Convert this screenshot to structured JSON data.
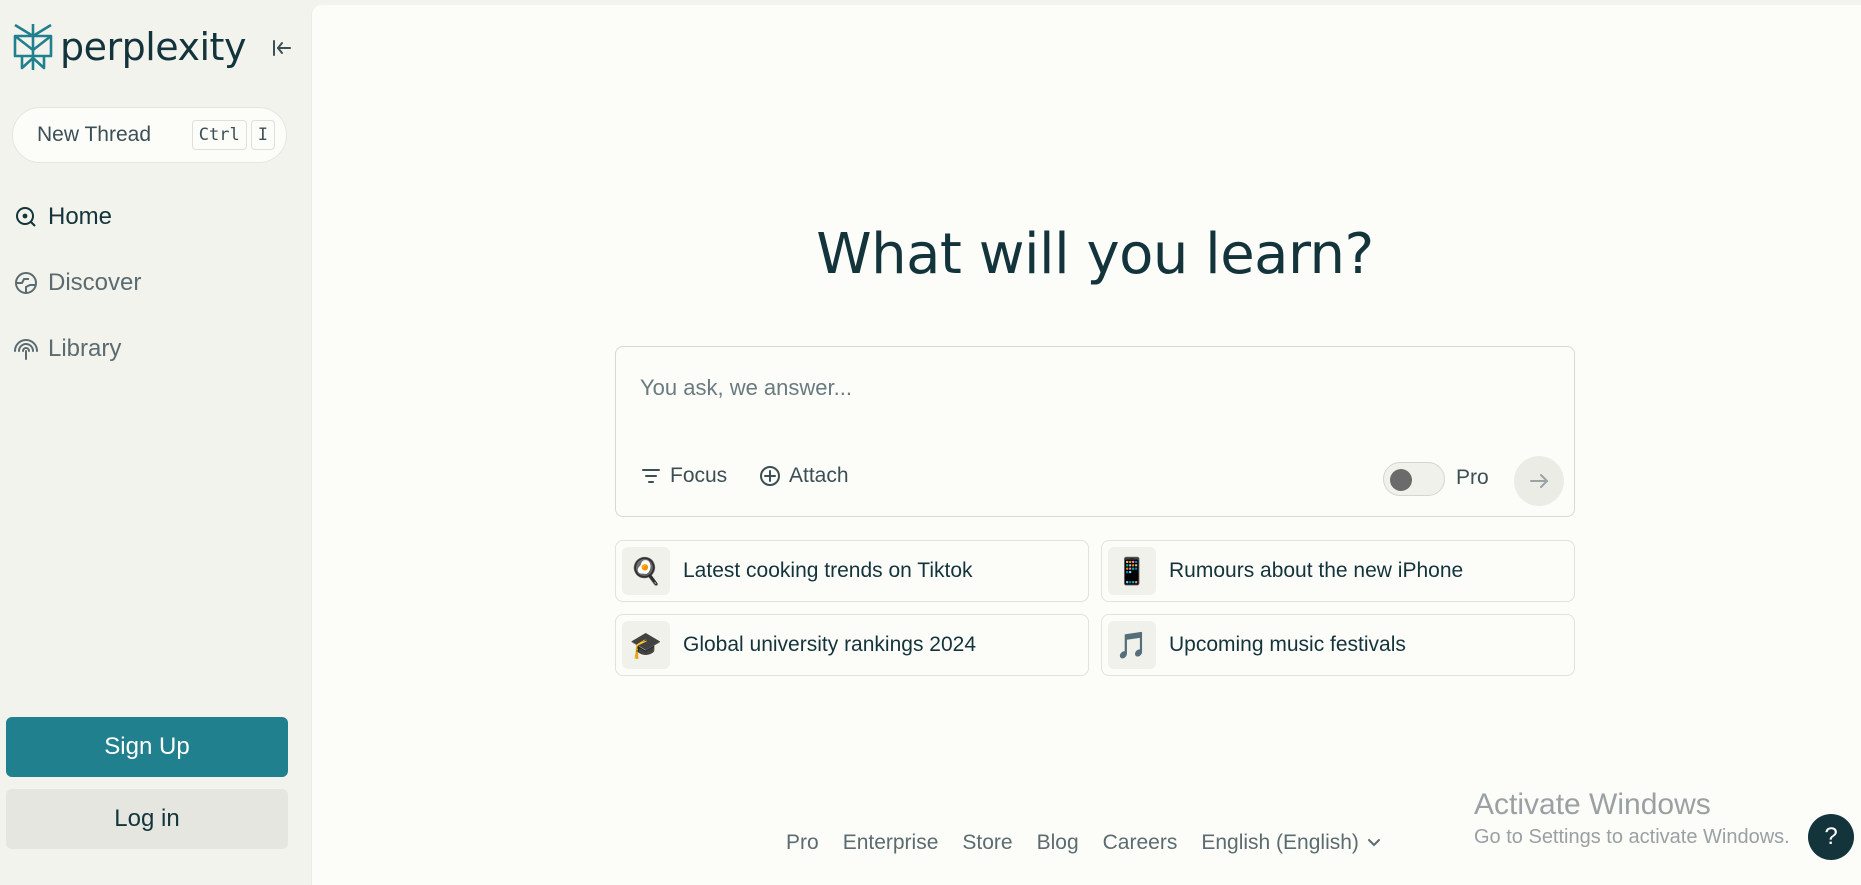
{
  "brand": {
    "name": "perplexity",
    "accent": "#20808d",
    "dark": "#13343b"
  },
  "sidebar": {
    "new_thread": {
      "label": "New Thread",
      "shortcut": [
        "Ctrl",
        "I"
      ]
    },
    "nav": [
      {
        "label": "Home",
        "icon": "home-search-icon",
        "active": true
      },
      {
        "label": "Discover",
        "icon": "globe-icon",
        "active": false
      },
      {
        "label": "Library",
        "icon": "library-icon",
        "active": false
      }
    ],
    "signup_label": "Sign Up",
    "login_label": "Log in"
  },
  "main": {
    "title": "What will you learn?",
    "ask": {
      "placeholder": "You ask, we answer...",
      "focus_label": "Focus",
      "attach_label": "Attach",
      "pro_label": "Pro",
      "pro_enabled": false
    },
    "suggestions": [
      {
        "emoji": "🍳",
        "label": "Latest cooking trends on Tiktok"
      },
      {
        "emoji": "📱",
        "label": "Rumours about the new iPhone"
      },
      {
        "emoji": "🎓",
        "label": "Global university rankings 2024"
      },
      {
        "emoji": "🎵",
        "label": "Upcoming music festivals"
      }
    ]
  },
  "footer": {
    "links": [
      "Pro",
      "Enterprise",
      "Store",
      "Blog",
      "Careers"
    ],
    "language": "English (English)"
  },
  "watermark": {
    "line1": "Activate Windows",
    "line2": "Go to Settings to activate Windows."
  },
  "help_label": "?"
}
